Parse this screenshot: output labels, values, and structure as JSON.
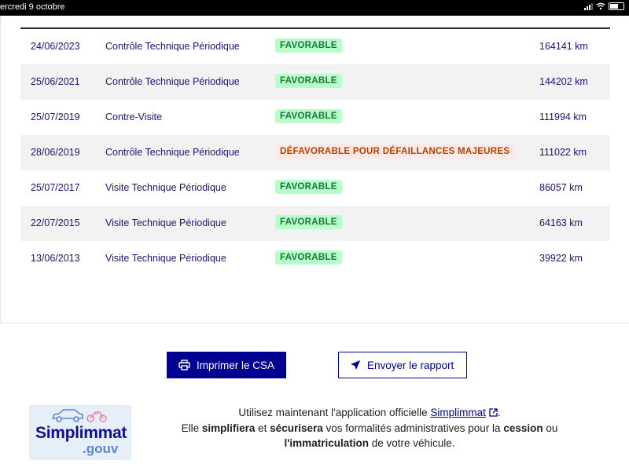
{
  "status_bar": {
    "date": "ercredi 9 octobre"
  },
  "history": {
    "rows": [
      {
        "date": "24/06/2023",
        "type": "Contrôle Technique Périodique",
        "result": "FAVORABLE",
        "status": "ok",
        "km": "164141 km"
      },
      {
        "date": "25/06/2021",
        "type": "Contrôle Technique Périodique",
        "result": "FAVORABLE",
        "status": "ok",
        "km": "144202 km"
      },
      {
        "date": "25/07/2019",
        "type": "Contre-Visite",
        "result": "FAVORABLE",
        "status": "ok",
        "km": "111994 km"
      },
      {
        "date": "28/06/2019",
        "type": "Contrôle Technique Périodique",
        "result": "DÉFAVORABLE POUR DÉFAILLANCES MAJEURES",
        "status": "ko",
        "km": "111022 km"
      },
      {
        "date": "25/07/2017",
        "type": "Visite Technique Périodique",
        "result": "FAVORABLE",
        "status": "ok",
        "km": "86057 km"
      },
      {
        "date": "22/07/2015",
        "type": "Visite Technique Périodique",
        "result": "FAVORABLE",
        "status": "ok",
        "km": "64163 km"
      },
      {
        "date": "13/06/2013",
        "type": "Visite Technique Périodique",
        "result": "FAVORABLE",
        "status": "ok",
        "km": "39922 km"
      }
    ]
  },
  "actions": {
    "print_label": "Imprimer le CSA",
    "send_label": "Envoyer le rapport"
  },
  "logo": {
    "name": "Simplimmat",
    "suffix": ".gouv"
  },
  "promo": {
    "t1": "Utilisez maintenant l'application officielle ",
    "link": "Simplimmat",
    "t2": ".",
    "t3": "Elle ",
    "b1": "simplifiera",
    "t4": " et ",
    "b2": "sécurisera",
    "t5": " vos formalités administratives pour la ",
    "b3": "cession",
    "t6": " ou",
    "b4": "l'immatriculation",
    "t7": " de votre véhicule."
  },
  "colors": {
    "primary": "#000091",
    "ok_bg": "#b8fec9",
    "ok_text": "#18753c",
    "ko_bg": "#ffe9e6",
    "ko_text": "#b34000"
  }
}
